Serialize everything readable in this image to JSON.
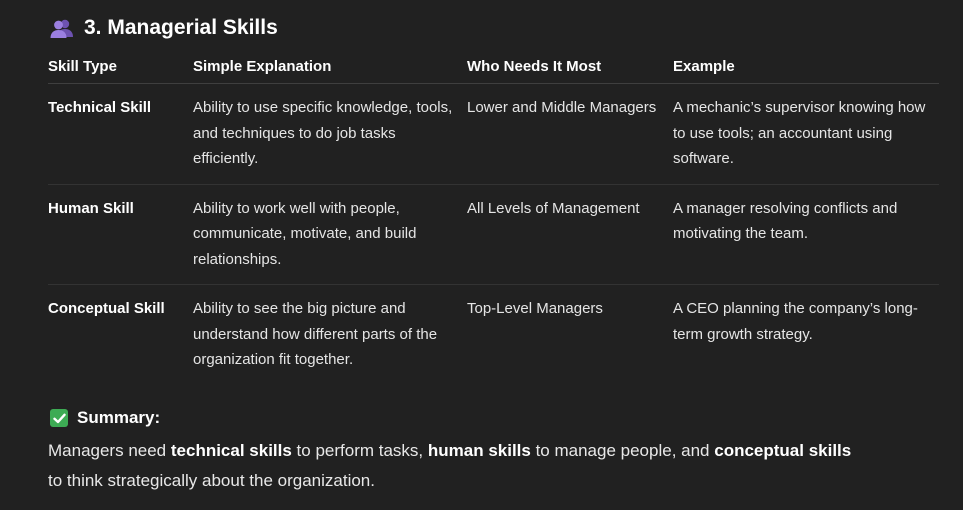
{
  "section": {
    "icon": "people-icon",
    "title": "3. Managerial Skills"
  },
  "table": {
    "headers": [
      "Skill Type",
      "Simple Explanation",
      "Who Needs It Most",
      "Example"
    ],
    "rows": [
      {
        "type": "Technical Skill",
        "explanation": "Ability to use specific knowledge, tools, and techniques to do job tasks efficiently.",
        "who": "Lower and Middle Managers",
        "example": "A mechanic’s supervisor knowing how to use tools; an accountant using software."
      },
      {
        "type": "Human Skill",
        "explanation": "Ability to work well with people, communicate, motivate, and build relationships.",
        "who": "All Levels of Management",
        "example": "A manager resolving conflicts and motivating the team."
      },
      {
        "type": "Conceptual Skill",
        "explanation": "Ability to see the big picture and understand how different parts of the organization fit together.",
        "who": "Top-Level Managers",
        "example": "A CEO planning the company’s long-term growth strategy."
      }
    ]
  },
  "summary": {
    "icon": "check-mark-icon",
    "label": "Summary:",
    "parts": [
      "Managers need ",
      "technical skills",
      " to perform tasks, ",
      "human skills",
      " to manage people, and ",
      "conceptual skills",
      " to think strategically about the organization."
    ]
  },
  "colors": {
    "background": "#212121",
    "check_green": "#3dab54",
    "people_purple": "#8c6fd1"
  }
}
